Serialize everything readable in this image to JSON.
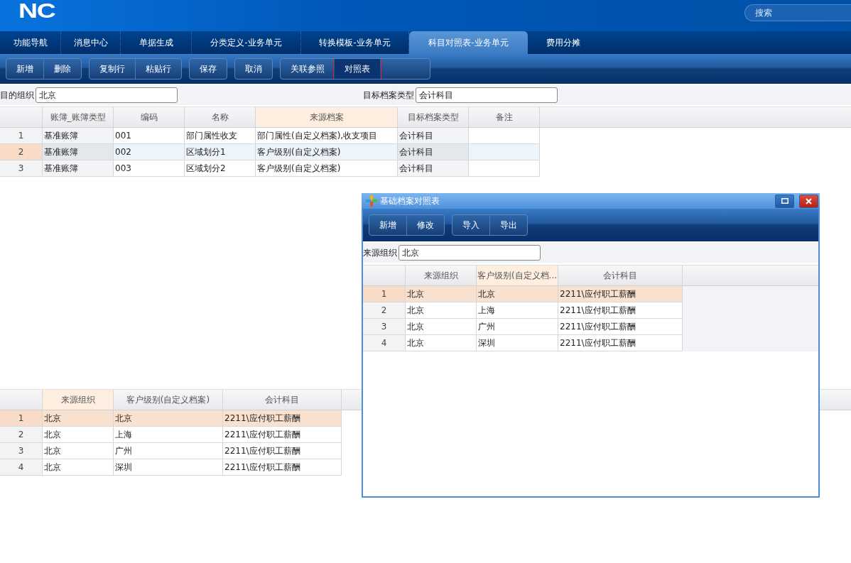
{
  "header": {
    "logo": "NC",
    "search": {
      "placeholder": "搜索"
    }
  },
  "tabs": [
    {
      "label": "功能导航",
      "selected": false
    },
    {
      "label": "消息中心",
      "selected": false
    },
    {
      "label": "单据生成",
      "selected": false
    },
    {
      "label": "分类定义-业务单元",
      "selected": false
    },
    {
      "label": "转换模板-业务单元",
      "selected": false
    },
    {
      "label": "科目对照表-业务单元",
      "selected": true
    },
    {
      "label": "费用分摊",
      "selected": false
    }
  ],
  "toolbar": [
    {
      "buttons": [
        {
          "label": "新增",
          "pressed": false,
          "highlighted": false
        },
        {
          "label": "删除",
          "pressed": false,
          "highlighted": false
        }
      ]
    },
    {
      "buttons": [
        {
          "label": "复制行",
          "pressed": false,
          "highlighted": false
        },
        {
          "label": "粘贴行",
          "pressed": false,
          "highlighted": false
        }
      ]
    },
    {
      "buttons": [
        {
          "label": "保存",
          "pressed": false,
          "highlighted": false
        }
      ]
    },
    {
      "buttons": [
        {
          "label": "取消",
          "pressed": false,
          "highlighted": false
        }
      ]
    },
    {
      "buttons": [
        {
          "label": "关联参照",
          "pressed": false,
          "highlighted": false
        },
        {
          "label": "对照表",
          "pressed": true,
          "highlighted": true
        }
      ]
    }
  ],
  "form": [
    {
      "label": "目的组织",
      "value": "北京"
    },
    {
      "label": "目标档案类型",
      "value": "会计科目"
    }
  ],
  "main_table": {
    "columns": [
      {
        "label": "账簿_账簿类型",
        "focused": false
      },
      {
        "label": "编码",
        "focused": false
      },
      {
        "label": "名称",
        "focused": false
      },
      {
        "label": "来源档案",
        "focused": true
      },
      {
        "label": "目标档案类型",
        "focused": false
      },
      {
        "label": "备注",
        "focused": false
      }
    ],
    "rows": [
      {
        "no": "1",
        "selected": false,
        "cells": [
          "基准账簿",
          "001",
          "部门属性收支",
          "部门属性(自定义档案),收支项目",
          "会计科目",
          ""
        ]
      },
      {
        "no": "2",
        "selected": true,
        "cells": [
          "基准账簿",
          "002",
          "区域划分1",
          "客户级别(自定义档案)",
          "会计科目",
          ""
        ]
      },
      {
        "no": "3",
        "selected": false,
        "cells": [
          "基准账簿",
          "003",
          "区域划分2",
          "客户级别(自定义档案)",
          "会计科目",
          ""
        ]
      }
    ]
  },
  "bottom_table": {
    "columns": [
      {
        "label": "来源组织",
        "focused": true
      },
      {
        "label": "客户级别(自定义档案)",
        "focused": false
      },
      {
        "label": "会计科目",
        "focused": false
      }
    ],
    "rows": [
      {
        "no": "1",
        "selected": true,
        "cells": [
          "北京",
          "北京",
          "2211\\应付职工薪酬"
        ]
      },
      {
        "no": "2",
        "selected": false,
        "cells": [
          "北京",
          "上海",
          "2211\\应付职工薪酬"
        ]
      },
      {
        "no": "3",
        "selected": false,
        "cells": [
          "北京",
          "广州",
          "2211\\应付职工薪酬"
        ]
      },
      {
        "no": "4",
        "selected": false,
        "cells": [
          "北京",
          "深圳",
          "2211\\应付职工薪酬"
        ]
      }
    ]
  },
  "dialog": {
    "title": "基础档案对照表",
    "toolbar": [
      {
        "buttons": [
          {
            "label": "新增",
            "pressed": false,
            "highlighted": false
          },
          {
            "label": "修改",
            "pressed": false,
            "highlighted": false
          }
        ]
      },
      {
        "buttons": [
          {
            "label": "导入",
            "pressed": false,
            "highlighted": false
          },
          {
            "label": "导出",
            "pressed": false,
            "highlighted": false
          }
        ]
      }
    ],
    "form": [
      {
        "label": "来源组织",
        "value": "北京"
      }
    ],
    "table": {
      "columns": [
        {
          "label": "来源组织",
          "focused": false
        },
        {
          "label": "客户级别(自定义档...",
          "focused": true
        },
        {
          "label": "会计科目",
          "focused": false
        }
      ],
      "rows": [
        {
          "no": "1",
          "selected": true,
          "cells": [
            "北京",
            "北京",
            "2211\\应付职工薪酬"
          ]
        },
        {
          "no": "2",
          "selected": false,
          "cells": [
            "北京",
            "上海",
            "2211\\应付职工薪酬"
          ]
        },
        {
          "no": "3",
          "selected": false,
          "cells": [
            "北京",
            "广州",
            "2211\\应付职工薪酬"
          ]
        },
        {
          "no": "4",
          "selected": false,
          "cells": [
            "北京",
            "深圳",
            "2211\\应付职工薪酬"
          ]
        }
      ]
    }
  }
}
